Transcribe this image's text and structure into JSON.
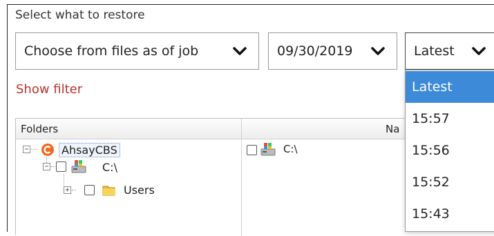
{
  "section_title": "Select what to restore",
  "source_dropdown": {
    "value": "Choose from files as of job"
  },
  "date_dropdown": {
    "value": "09/30/2019"
  },
  "time_dropdown": {
    "value": "Latest"
  },
  "show_filter_label": "Show filter",
  "tree": {
    "columns": {
      "folders": "Folders",
      "name": "Na"
    },
    "root": "AhsayCBS",
    "drive": "C:\\",
    "users": "Users"
  },
  "list_items": [
    {
      "name": "C:\\"
    }
  ],
  "time_menu": {
    "items": [
      {
        "label": "Latest",
        "selected": true
      },
      {
        "label": "15:57"
      },
      {
        "label": "15:56"
      },
      {
        "label": "15:52"
      },
      {
        "label": "15:43"
      }
    ]
  },
  "colors": {
    "link": "#b8322f",
    "selection": "#3d8ad8",
    "ahsay_orange": "#ee6a1f",
    "folder_yellow": "#f2c533"
  }
}
